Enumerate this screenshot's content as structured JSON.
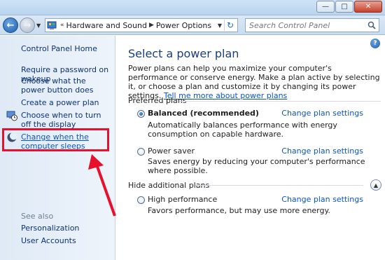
{
  "address": {
    "breadcrumbs": [
      "Hardware and Sound",
      "Power Options"
    ],
    "search_placeholder": "Search Control Panel"
  },
  "sidebar": {
    "home": "Control Panel Home",
    "items": [
      {
        "label": "Require a password on wakeup"
      },
      {
        "label": "Choose what the power button does"
      },
      {
        "label": "Create a power plan"
      },
      {
        "label": "Choose when to turn off the display"
      },
      {
        "label": "Change when the computer sleeps"
      }
    ],
    "see_also": "See also",
    "see_also_items": [
      {
        "label": "Personalization"
      },
      {
        "label": "User Accounts"
      }
    ]
  },
  "main": {
    "title": "Select a power plan",
    "intro": "Power plans can help you maximize your computer's performance or conserve energy. Make a plan active by selecting it, or choose a plan and customize it by changing its power settings.",
    "intro_link": "Tell me more about power plans",
    "preferred_heading": "Preferred plans",
    "hidden_heading": "Hide additional plans",
    "plans": [
      {
        "name": "Balanced (recommended)",
        "desc": "Automatically balances performance with energy consumption on capable hardware.",
        "link": "Change plan settings",
        "selected": true
      },
      {
        "name": "Power saver",
        "desc": "Saves energy by reducing your computer's performance where possible.",
        "link": "Change plan settings",
        "selected": false
      },
      {
        "name": "High performance",
        "desc": "Favors performance, but may use more energy.",
        "link": "Change plan settings",
        "selected": false
      }
    ]
  },
  "icons": {
    "back": "back-arrow-icon",
    "forward": "forward-arrow-icon",
    "refresh": "refresh-icon",
    "search": "search-icon",
    "help": "help-icon"
  },
  "colors": {
    "link": "#0b54c7",
    "title": "#1b3e7a",
    "highlight": "#e8102c"
  }
}
